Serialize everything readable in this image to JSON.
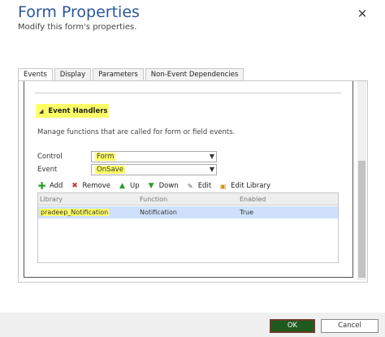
{
  "dialog": {
    "title": "Form Properties",
    "subtitle": "Modify this form's properties.",
    "close_label": "✕"
  },
  "tabs": [
    {
      "label": "Events",
      "active": true
    },
    {
      "label": "Display",
      "active": false
    },
    {
      "label": "Parameters",
      "active": false
    },
    {
      "label": "Non-Event Dependencies",
      "active": false
    }
  ],
  "event_handlers": {
    "section_title": "Event Handlers",
    "description": "Manage functions that are called for form or field events.",
    "control_label": "Control",
    "control_value": "Form",
    "event_label": "Event",
    "event_value": "OnSave"
  },
  "toolbar": {
    "add": "Add",
    "remove": "Remove",
    "up": "Up",
    "down": "Down",
    "edit": "Edit",
    "edit_library": "Edit Library"
  },
  "grid": {
    "columns": [
      "Library",
      "Function",
      "Enabled"
    ],
    "rows": [
      [
        "pradeep_Notification",
        "Notification",
        "True"
      ]
    ]
  },
  "footer": {
    "ok": "OK",
    "cancel": "Cancel"
  },
  "colors": {
    "title": "#2b579a",
    "highlight": "#ffff66",
    "selected_row": "#cfe1fa",
    "ok_button": "#1e5a1e"
  }
}
